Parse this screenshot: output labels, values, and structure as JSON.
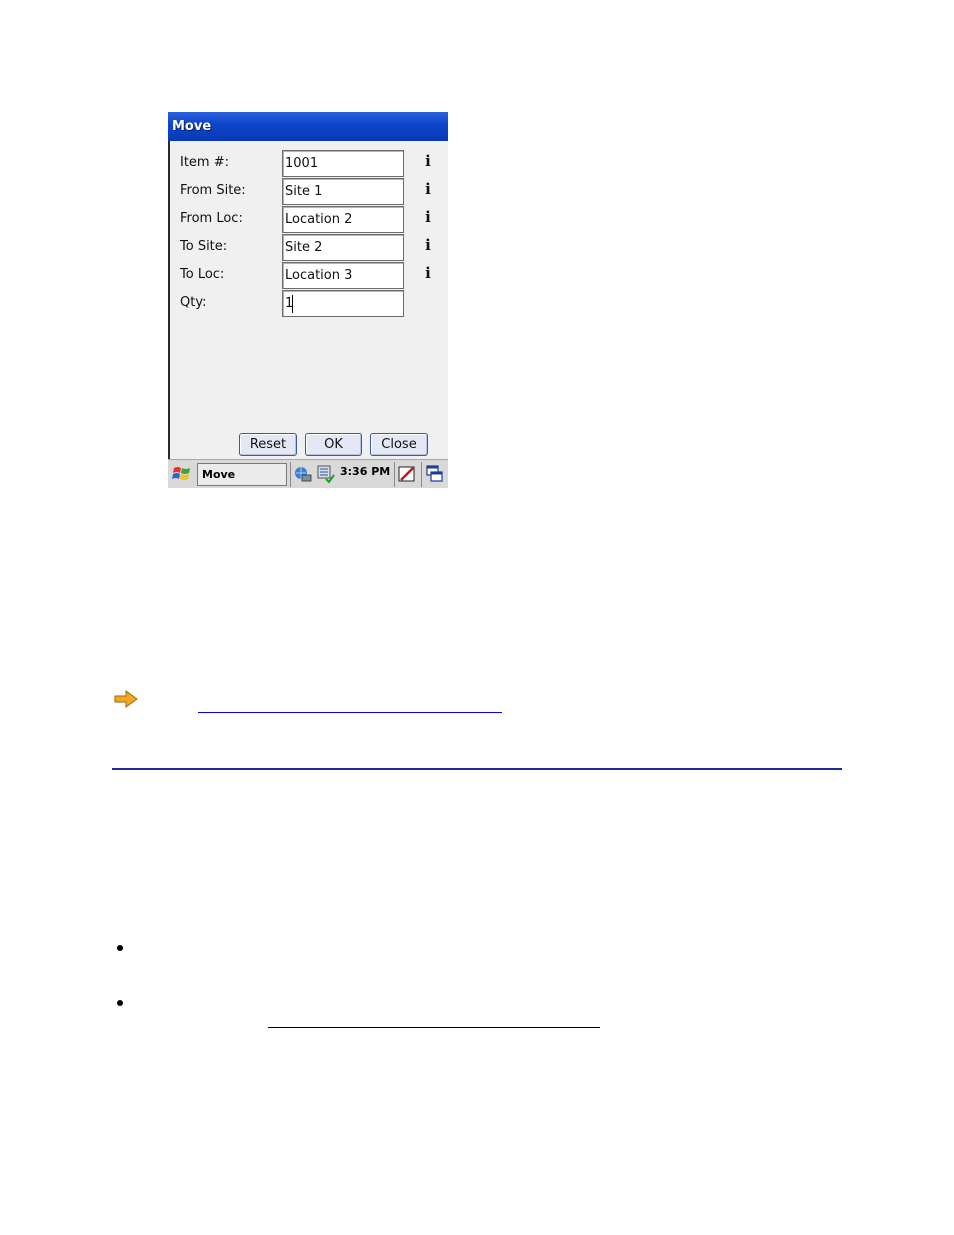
{
  "window": {
    "title": "Move"
  },
  "form": {
    "fields": [
      {
        "label": "Item #:",
        "value": "1001",
        "info": "i"
      },
      {
        "label": "From Site:",
        "value": "Site 1",
        "info": "i"
      },
      {
        "label": "From Loc:",
        "value": "Location 2",
        "info": "i"
      },
      {
        "label": "To Site:",
        "value": "Site 2",
        "info": "i"
      },
      {
        "label": "To Loc:",
        "value": "Location 3",
        "info": "i"
      },
      {
        "label": "Qty:",
        "value": "1",
        "info": ""
      }
    ]
  },
  "buttons": {
    "reset": "Reset",
    "ok": "OK",
    "close": "Close"
  },
  "taskbar": {
    "task_label": "Move",
    "clock": "3:36 PM"
  },
  "icons": {
    "start": "windows-flag-icon",
    "network": "network-icon",
    "keyboard": "input-panel-icon",
    "edit": "edit-icon",
    "windows": "window-switch-icon",
    "note": "arrow-right-icon"
  },
  "colors": {
    "titlebar": "#0c44c8",
    "link_underline": "#0000ee",
    "rule": "#1e2a9e"
  }
}
